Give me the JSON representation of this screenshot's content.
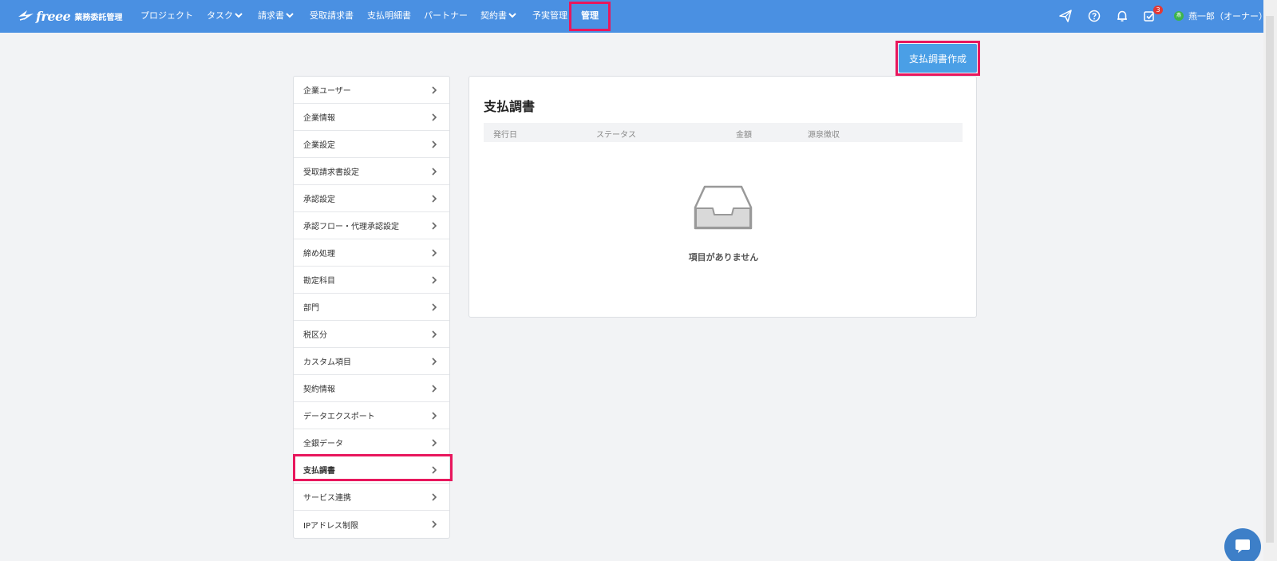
{
  "header": {
    "logo_text": "freee",
    "product_name": "業務委託管理",
    "nav": [
      {
        "label": "プロジェクト"
      },
      {
        "label": "タスク"
      },
      {
        "label": "請求書"
      },
      {
        "label": "受取請求書"
      },
      {
        "label": "支払明細書"
      },
      {
        "label": "パートナー"
      },
      {
        "label": "契約書"
      },
      {
        "label": "予実管理"
      },
      {
        "label": "管理"
      }
    ],
    "icons": [
      "send-icon",
      "help-icon",
      "bell-icon",
      "task-check-icon"
    ],
    "task_badge": "3",
    "user_avatar": "燕",
    "user_name": "燕一郎（オーナー）"
  },
  "toolbar": {
    "create_label": "支払調書作成"
  },
  "sidebar": {
    "items": [
      {
        "label": "企業ユーザー"
      },
      {
        "label": "企業情報"
      },
      {
        "label": "企業設定"
      },
      {
        "label": "受取請求書設定"
      },
      {
        "label": "承認設定"
      },
      {
        "label": "承認フロー・代理承認設定"
      },
      {
        "label": "締め処理"
      },
      {
        "label": "勘定科目"
      },
      {
        "label": "部門"
      },
      {
        "label": "税区分"
      },
      {
        "label": "カスタム項目"
      },
      {
        "label": "契約情報"
      },
      {
        "label": "データエクスポート"
      },
      {
        "label": "全銀データ"
      },
      {
        "label": "支払調書"
      },
      {
        "label": "サービス連携"
      },
      {
        "label": "IPアドレス制限"
      }
    ],
    "active_index": 14
  },
  "main": {
    "title": "支払調書",
    "columns": [
      "発行日",
      "ステータス",
      "金額",
      "源泉徴収"
    ],
    "empty_message": "項目がありません"
  },
  "colors": {
    "nav_bg": "#4a90e2",
    "highlight": "#e8175d",
    "button_bg": "#4a9fe6",
    "badge": "#e53935"
  }
}
